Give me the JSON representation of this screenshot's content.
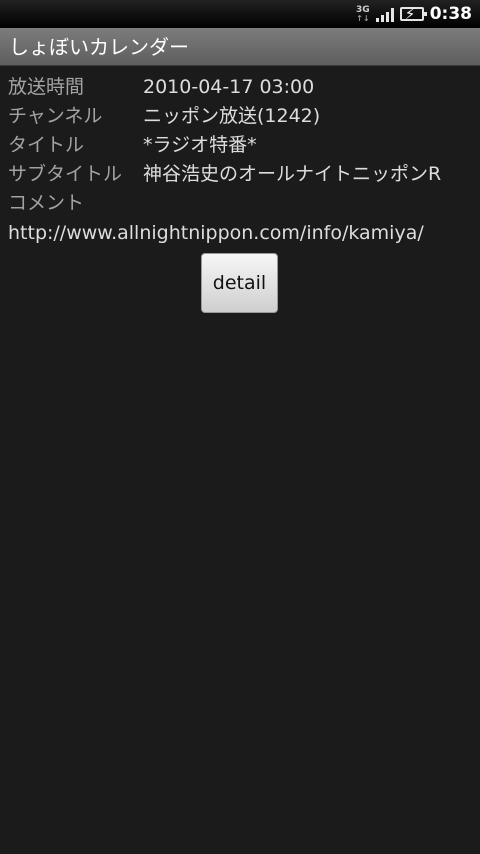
{
  "status_bar": {
    "network": "3G",
    "network_arrows": "↑↓",
    "time": "0:38"
  },
  "app": {
    "title": "しょぼいカレンダー"
  },
  "details": [
    {
      "label": "放送時間",
      "value": "2010-04-17 03:00"
    },
    {
      "label": "チャンネル",
      "value": "ニッポン放送(1242)"
    },
    {
      "label": "タイトル",
      "value": "*ラジオ特番*"
    },
    {
      "label": "サブタイトル",
      "value": "神谷浩史のオールナイトニッポンR"
    },
    {
      "label": "コメント",
      "value": ""
    }
  ],
  "comment_url": "http://www.allnightnippon.com/info/kamiya/",
  "detail_button_label": "detail",
  "icons": [
    "3g-icon",
    "signal-icon",
    "battery-charging-icon"
  ]
}
